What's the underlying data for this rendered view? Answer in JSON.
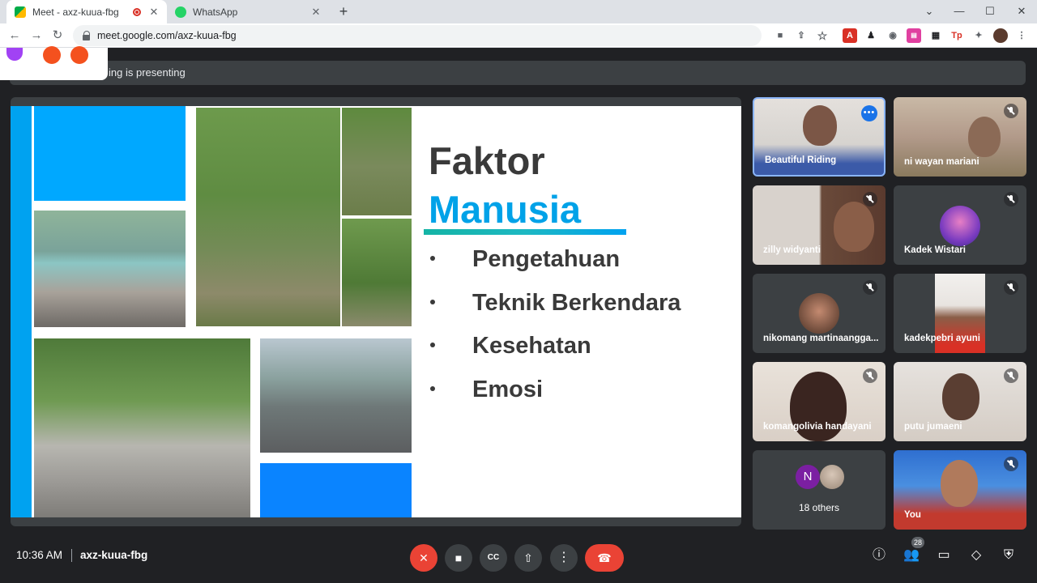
{
  "browser": {
    "tabs": [
      {
        "title": "Meet - axz-kuua-fbg",
        "active": true,
        "recording": true
      },
      {
        "title": "WhatsApp",
        "active": false
      }
    ],
    "url": "meet.google.com/axz-kuua-fbg"
  },
  "meet": {
    "presenting_text": "ing is presenting",
    "slide": {
      "title_line1": "Faktor",
      "title_line2": "Manusia",
      "bullets": [
        "Pengetahuan",
        "Teknik Berkendara",
        "Kesehatan",
        "Emosi"
      ]
    },
    "participants": [
      {
        "name": "Beautiful Riding",
        "pinned_menu": true
      },
      {
        "name": "ni wayan mariani",
        "muted": true
      },
      {
        "name": "zilly widyanti",
        "muted": true
      },
      {
        "name": "Kadek Wistari",
        "muted": true
      },
      {
        "name": "nikomang martinaangga...",
        "muted": true
      },
      {
        "name": "kadekpebri ayuni",
        "muted": true
      },
      {
        "name": "komangolivia handayani",
        "muted": true
      },
      {
        "name": "putu jumaeni",
        "muted": true
      },
      {
        "name": "18 others",
        "avatar_letter": "N"
      },
      {
        "name": "You",
        "muted": true
      }
    ],
    "bottom": {
      "time": "10:36 AM",
      "meeting_code": "axz-kuua-fbg",
      "people_count": "28"
    }
  },
  "colors": {
    "accent_blue": "#1a73e8",
    "end_call_red": "#ea4335",
    "slide_blue": "#00a2e8"
  }
}
